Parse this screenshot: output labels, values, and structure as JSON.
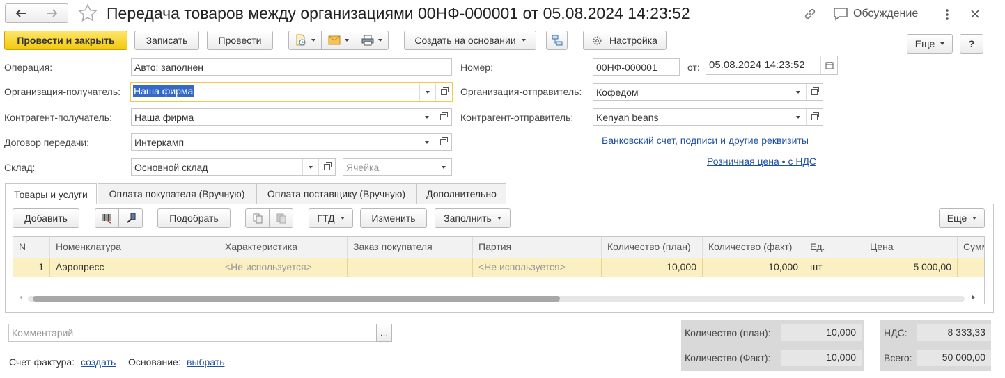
{
  "window": {
    "title": "Передача товаров между организациями 00НФ-000001 от 05.08.2024 14:23:52",
    "discussion_label": "Обсуждение"
  },
  "toolbar": {
    "post_close": "Провести и закрыть",
    "save": "Записать",
    "post": "Провести",
    "create_based": "Создать на основании",
    "settings": "Настройка",
    "more": "Еще",
    "help": "?"
  },
  "form": {
    "operation_label": "Операция:",
    "operation_value": "Авто: заполнен",
    "number_label": "Номер:",
    "number_value": "00НФ-000001",
    "date_label": "от:",
    "date_value": "05.08.2024 14:23:52",
    "org_recv_label": "Организация-получатель:",
    "org_recv_value": "Наша фирма",
    "org_send_label": "Организация-отправитель:",
    "org_send_value": "Кофедом",
    "ctr_recv_label": "Контрагент-получатель:",
    "ctr_recv_value": "Наша фирма",
    "ctr_send_label": "Контрагент-отправитель:",
    "ctr_send_value": "Kenyan beans",
    "contract_label": "Договор передачи:",
    "contract_value": "Интеркамп",
    "bank_link": "Банковский счет, подписи и другие реквизиты",
    "warehouse_label": "Склад:",
    "warehouse_value": "Основной склад",
    "cell_placeholder": "Ячейка",
    "price_link": "Розничная цена • с НДС"
  },
  "tabs": [
    "Товары и услуги",
    "Оплата покупателя (Вручную)",
    "Оплата поставщику (Вручную)",
    "Дополнительно"
  ],
  "table_toolbar": {
    "add": "Добавить",
    "pick": "Подобрать",
    "gtd": "ГТД",
    "change": "Изменить",
    "fill": "Заполнить",
    "more": "Еще"
  },
  "table": {
    "columns": [
      "N",
      "Номенклатура",
      "Характеристика",
      "Заказ покупателя",
      "Партия",
      "Количество (план)",
      "Количество (факт)",
      "Ед.",
      "Цена",
      "Сумм"
    ],
    "rows": [
      [
        "1",
        "Аэропресс",
        "<Не используется>",
        "",
        "<Не используется>",
        "10,000",
        "10,000",
        "шт",
        "5 000,00",
        ""
      ]
    ]
  },
  "footer": {
    "comment_placeholder": "Комментарий",
    "invoice_label": "Счет-фактура:",
    "invoice_link": "создать",
    "basis_label": "Основание:",
    "basis_link": "выбрать",
    "qty_plan_label": "Количество (план):",
    "qty_plan_value": "10,000",
    "qty_fact_label": "Количество (Факт):",
    "qty_fact_value": "10,000",
    "vat_label": "НДС:",
    "vat_value": "8 333,33",
    "total_label": "Всего:",
    "total_value": "50 000,00"
  },
  "colors": {
    "primary_button": "#f3c90d",
    "focus_border": "#f0c94a",
    "selected_row": "#fbf0c2",
    "link": "#1f4fa3"
  }
}
